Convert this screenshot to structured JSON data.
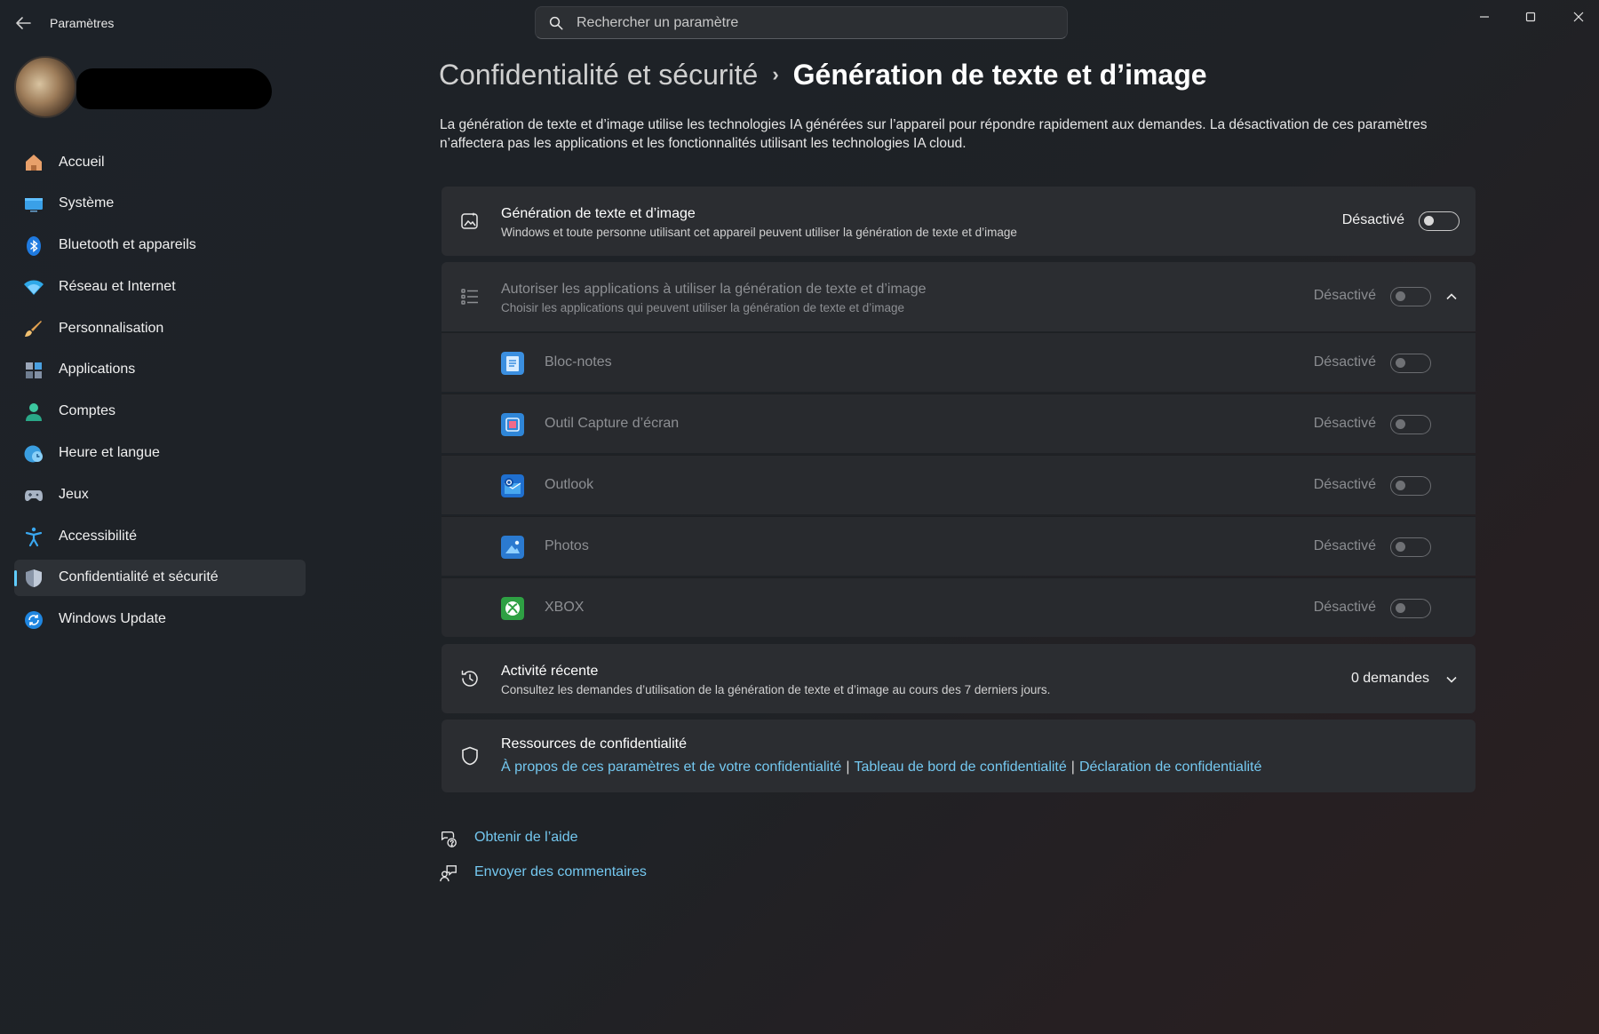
{
  "window": {
    "app_title": "Paramètres",
    "search_placeholder": "Rechercher un paramètre"
  },
  "sidebar": {
    "items": [
      {
        "label": "Accueil",
        "icon": "home-icon"
      },
      {
        "label": "Système",
        "icon": "system-icon"
      },
      {
        "label": "Bluetooth et appareils",
        "icon": "bluetooth-icon"
      },
      {
        "label": "Réseau et Internet",
        "icon": "wifi-icon"
      },
      {
        "label": "Personnalisation",
        "icon": "brush-icon"
      },
      {
        "label": "Applications",
        "icon": "apps-icon"
      },
      {
        "label": "Comptes",
        "icon": "account-icon"
      },
      {
        "label": "Heure et langue",
        "icon": "clock-globe-icon"
      },
      {
        "label": "Jeux",
        "icon": "gamepad-icon"
      },
      {
        "label": "Accessibilité",
        "icon": "accessibility-icon"
      },
      {
        "label": "Confidentialité et sécurité",
        "icon": "shield-icon",
        "selected": true
      },
      {
        "label": "Windows Update",
        "icon": "update-icon"
      }
    ]
  },
  "main": {
    "breadcrumb_parent": "Confidentialité et sécurité",
    "breadcrumb_current": "Génération de texte et d’image",
    "description": "La génération de texte et d’image utilise les technologies IA générées sur l’appareil pour répondre rapidement aux demandes. La désactivation de ces paramètres n’affectera pas les applications et les fonctionnalités utilisant les technologies IA cloud.",
    "main_setting": {
      "title": "Génération de texte et d’image",
      "subtitle": "Windows et toute personne utilisant cet appareil peuvent utiliser la génération de texte et d’image",
      "state": "Désactivé"
    },
    "apps_setting": {
      "title": "Autoriser les applications à utiliser la génération de texte et d’image",
      "subtitle": "Choisir les applications qui peuvent utiliser la génération de texte et d’image",
      "state": "Désactivé"
    },
    "apps": [
      {
        "name": "Bloc-notes",
        "state": "Désactivé",
        "color": "#3b8fe0"
      },
      {
        "name": "Outil Capture d’écran",
        "state": "Désactivé",
        "color": "#2f86d8"
      },
      {
        "name": "Outlook",
        "state": "Désactivé",
        "color": "#1f6fcf"
      },
      {
        "name": "Photos",
        "state": "Désactivé",
        "color": "#2b7ad0"
      },
      {
        "name": "XBOX",
        "state": "Désactivé",
        "color": "#2ea043"
      }
    ],
    "recent_activity": {
      "title": "Activité récente",
      "subtitle": "Consultez les demandes d’utilisation de la génération de texte et d’image au cours des 7 derniers jours.",
      "count": "0 demandes"
    },
    "privacy_resources": {
      "title": "Ressources de confidentialité",
      "link1": "À propos de ces paramètres et de votre confidentialité",
      "link2": "Tableau de bord de confidentialité",
      "link3": "Déclaration de confidentialité",
      "separator": "|"
    },
    "footer": {
      "help": "Obtenir de l’aide",
      "feedback": "Envoyer des commentaires"
    }
  },
  "colors": {
    "accent": "#60cdff",
    "link": "#74c8f0"
  }
}
